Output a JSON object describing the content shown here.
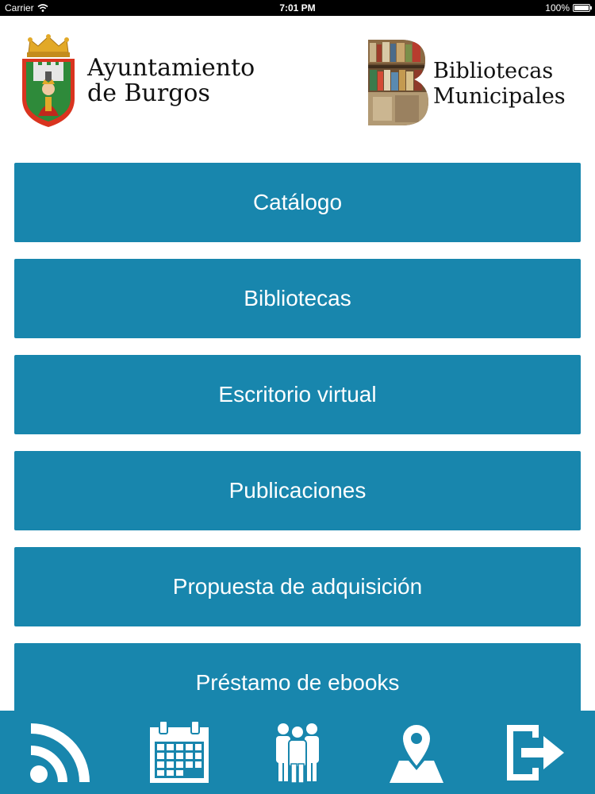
{
  "status_bar": {
    "carrier": "Carrier",
    "time": "7:01 PM",
    "battery": "100%"
  },
  "header": {
    "left_logo": {
      "line1": "Ayuntamiento",
      "line2": "de Burgos"
    },
    "right_logo": {
      "line1": "Bibliotecas",
      "line2": "Municipales"
    }
  },
  "menu": {
    "items": [
      {
        "label": "Catálogo"
      },
      {
        "label": "Bibliotecas"
      },
      {
        "label": "Escritorio virtual"
      },
      {
        "label": "Publicaciones"
      },
      {
        "label": "Propuesta de adquisición"
      },
      {
        "label": "Préstamo de ebooks"
      }
    ]
  },
  "tab_bar": {
    "icons": [
      "rss-icon",
      "calendar-icon",
      "group-icon",
      "map-marker-icon",
      "logout-icon"
    ]
  },
  "colors": {
    "primary": "#1886ad",
    "status_bar": "#000000",
    "background": "#ffffff"
  }
}
